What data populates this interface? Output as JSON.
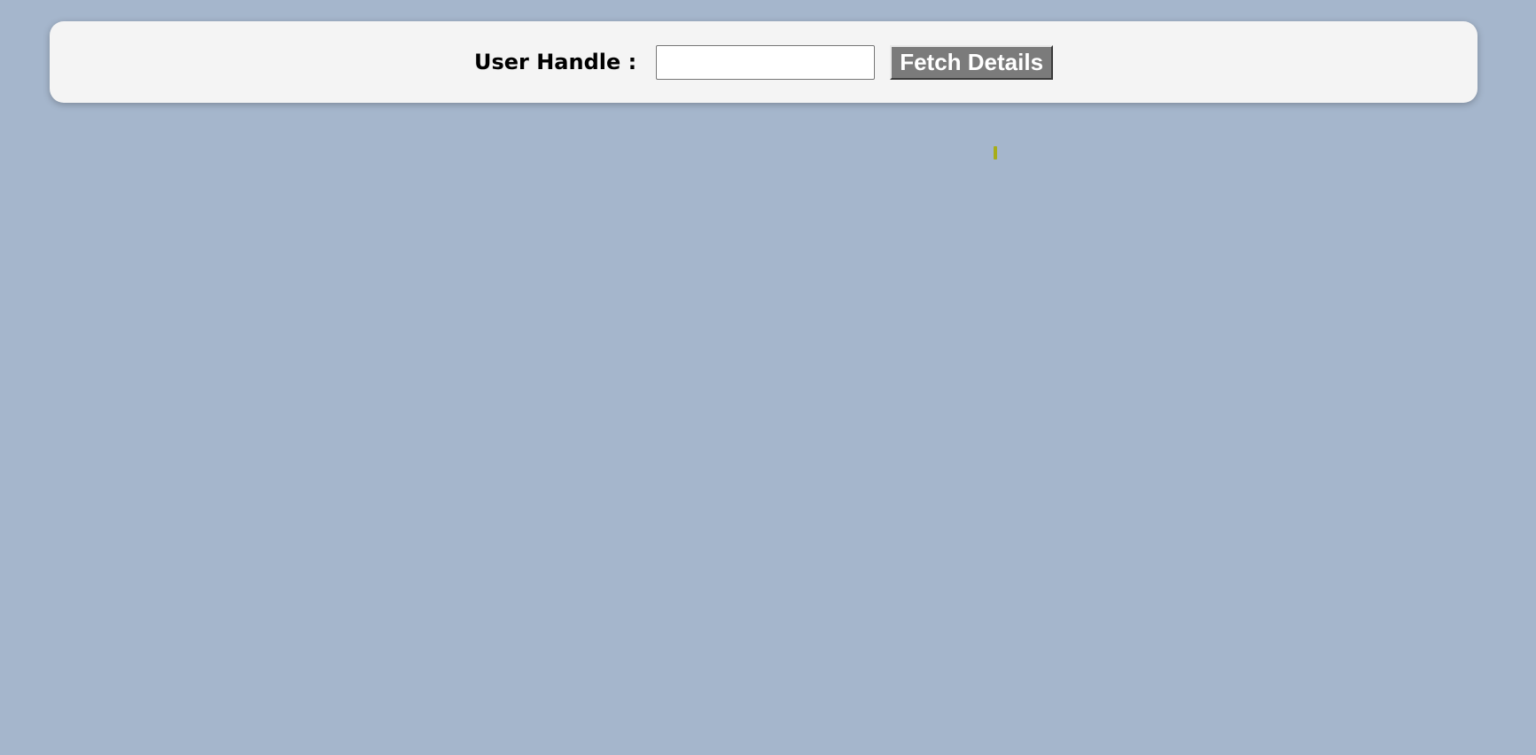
{
  "search": {
    "label": "User Handle :",
    "input_value": "",
    "input_placeholder": "",
    "button_label": "Fetch Details"
  },
  "colors": {
    "background": "#a5b6cc",
    "card": "#f4f4f4",
    "button": "#7b7b7b",
    "loader": "#a7ad18"
  }
}
